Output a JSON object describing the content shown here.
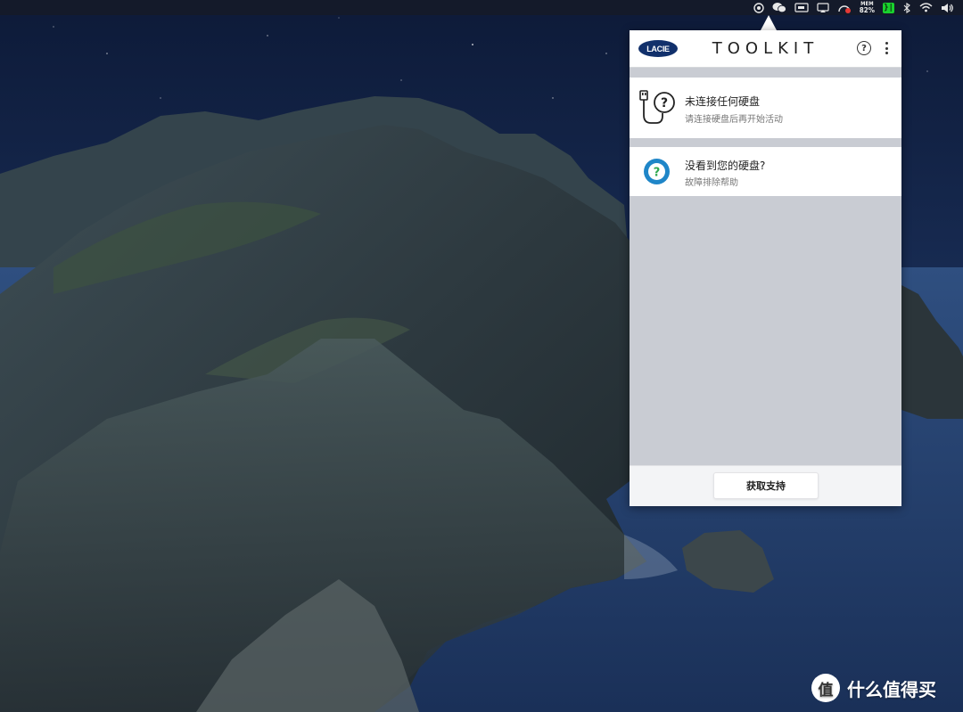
{
  "menubar": {
    "icons": [
      "lacie-toolkit-icon",
      "wechat-icon",
      "display-icon",
      "cast-icon",
      "monitor-icon",
      "memory-icon",
      "terminal-icon",
      "bluetooth-icon",
      "wifi-icon",
      "volume-icon"
    ],
    "mem_label": "MEM",
    "mem_value": "82%",
    "terminal_glyph": "}|"
  },
  "toolkit": {
    "logo_text": "LACIE",
    "title": "TOOLKIT",
    "help_glyph": "?",
    "no_drive": {
      "title": "未连接任何硬盘",
      "subtitle": "请连接硬盘后再开始活动"
    },
    "troubleshoot": {
      "title": "没看到您的硬盘?",
      "subtitle": "故障排除帮助"
    },
    "support_button": "获取支持"
  },
  "watermark": {
    "badge": "值",
    "text": "什么值得买"
  },
  "colors": {
    "menubar_bg": "#141a2a",
    "panel_bg": "#c9ccd3",
    "lacie_blue": "#11306b",
    "terminal_green": "#19d12e"
  }
}
